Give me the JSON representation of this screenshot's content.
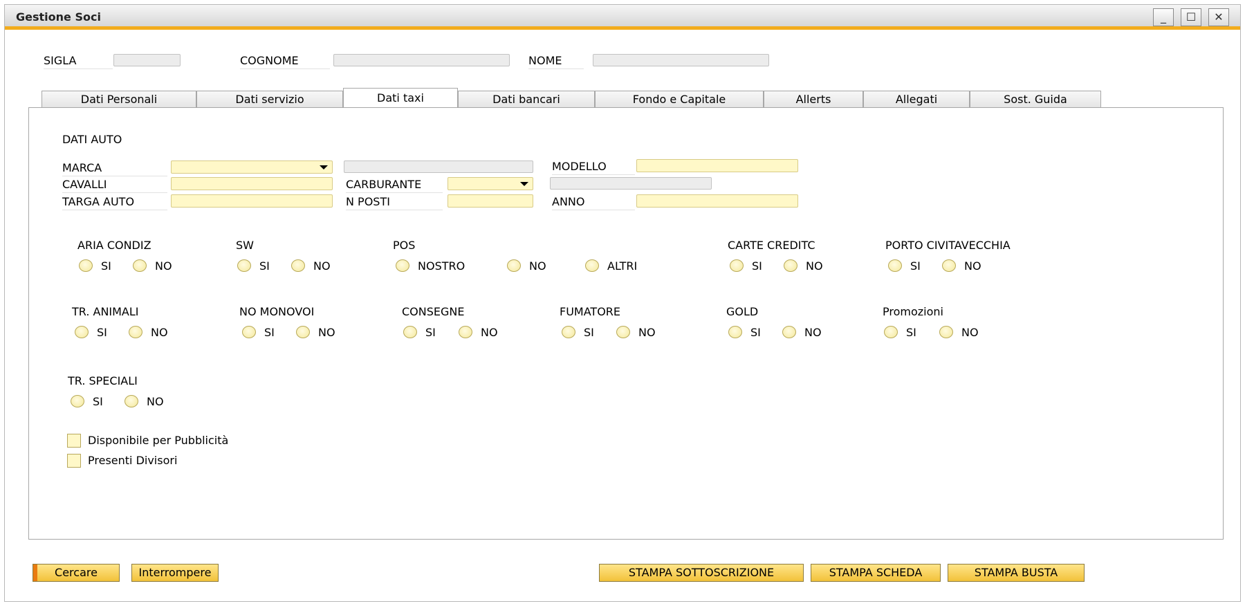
{
  "window": {
    "title": "Gestione Soci",
    "controls": {
      "minimize": "_",
      "maximize": "☐",
      "close": "✕"
    }
  },
  "header": {
    "sigla_label": "SIGLA",
    "sigla_value": "",
    "cognome_label": "COGNOME",
    "cognome_value": "",
    "nome_label": "NOME",
    "nome_value": ""
  },
  "tabs": [
    {
      "label": "Dati Personali"
    },
    {
      "label": "Dati servizio"
    },
    {
      "label": "Dati taxi"
    },
    {
      "label": "Dati bancari"
    },
    {
      "label": "Fondo e Capitale"
    },
    {
      "label": "Allerts"
    },
    {
      "label": "Allegati"
    },
    {
      "label": "Sost. Guida"
    }
  ],
  "active_tab": "Dati taxi",
  "dati_auto": {
    "section_title": "DATI AUTO",
    "marca_label": "MARCA",
    "modello_label": "MODELLO",
    "cavalli_label": "CAVALLI",
    "carburante_label": "CARBURANTE",
    "targa_label": "TARGA AUTO",
    "nposti_label": "N POSTI",
    "anno_label": "ANNO"
  },
  "options": {
    "aria_condiz": {
      "label": "ARIA CONDIZ",
      "opt1": "SI",
      "opt2": "NO"
    },
    "sw": {
      "label": "SW",
      "opt1": "SI",
      "opt2": "NO"
    },
    "pos": {
      "label": "POS",
      "opt1": "NOSTRO",
      "opt2": "NO",
      "opt3": "ALTRI"
    },
    "carte_credito": {
      "label": "CARTE CREDITC",
      "opt1": "SI",
      "opt2": "NO"
    },
    "porto_civitavecchia": {
      "label": "PORTO CIVITAVECCHIA",
      "opt1": "SI",
      "opt2": "NO"
    },
    "tr_animali": {
      "label": "TR. ANIMALI",
      "opt1": "SI",
      "opt2": "NO"
    },
    "no_monovoi": {
      "label": "NO MONOVOI",
      "opt1": "SI",
      "opt2": "NO"
    },
    "consegne": {
      "label": "CONSEGNE",
      "opt1": "SI",
      "opt2": "NO"
    },
    "fumatore": {
      "label": "FUMATORE",
      "opt1": "SI",
      "opt2": "NO"
    },
    "gold": {
      "label": "GOLD",
      "opt1": "SI",
      "opt2": "NO"
    },
    "promozioni": {
      "label": "Promozioni",
      "opt1": "SI",
      "opt2": "NO"
    },
    "tr_speciali": {
      "label": "TR. SPECIALI",
      "opt1": "SI",
      "opt2": "NO"
    }
  },
  "checkboxes": {
    "pubblicita": "Disponibile per Pubblicità",
    "divisori": "Presenti Divisori"
  },
  "buttons": {
    "cercare": "Cercare",
    "interrompere": "Interrompere",
    "stampa_sottoscrizione": "STAMPA SOTTOSCRIZIONE",
    "stampa_scheda": "STAMPA SCHEDA",
    "stampa_busta": "STAMPA BUSTA"
  },
  "colors": {
    "accent": "#f2ac1d",
    "field_yellow": "#fff8c8",
    "button_yellow": "#f2c23a"
  }
}
